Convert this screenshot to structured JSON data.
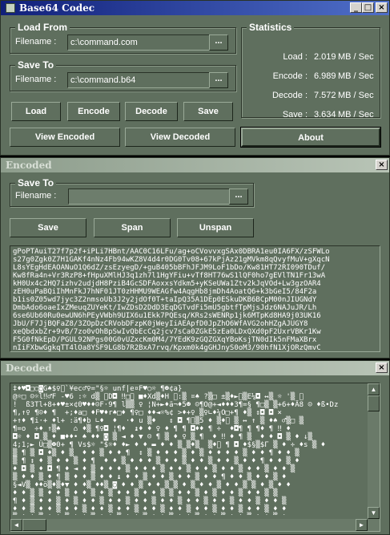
{
  "codec": {
    "title": "Base64 Codec",
    "load_from": {
      "title": "Load From",
      "filename_label": "Filename :",
      "filename": "c:\\command.com",
      "browse": "..."
    },
    "save_to": {
      "title": "Save To",
      "filename_label": "Filename :",
      "filename": "c:\\command.b64",
      "browse": "..."
    },
    "buttons": {
      "load": "Load",
      "encode": "Encode",
      "decode": "Decode",
      "save": "Save",
      "view_encoded": "View Encoded",
      "view_decoded": "View Decoded",
      "about": "About"
    },
    "stats": {
      "title": "Statistics",
      "rows": [
        {
          "label": "Load :",
          "value": "2.019",
          "unit": "MB / Sec"
        },
        {
          "label": "Encode :",
          "value": "6.989",
          "unit": "MB / Sec"
        },
        {
          "label": "Decode :",
          "value": "7.572",
          "unit": "MB / Sec"
        },
        {
          "label": "Save :",
          "value": "3.634",
          "unit": "MB / Sec"
        }
      ]
    }
  },
  "encoded": {
    "title": "Encoded",
    "save_to": {
      "title": "Save To",
      "filename_label": "Filename :",
      "filename": "",
      "browse": "..."
    },
    "buttons": {
      "save": "Save",
      "span": "Span",
      "unspan": "Unspan"
    },
    "text": "gPoPTAuiT27f7p2f+iPLi7HBnt/AAC0C16LFu/ag+oCVovvxgSAx0DBRA1eu0IA6FX/zSFWLo\ns27g0Zgk0Z7H1GAKf4nNz4Fb94wKZ8V4d4r0DG0Tv08+67kPjAz21gMVkm8qQvyfMuV+gXqcN\nL8sYEgHdEAOANuO1Q6dZ/zsEzyegD/+guB405bBFhJFJM9LoF1bDo/Kw81HT72RI090TDuf/\nKw8fRa4n+Vr3RzP8+fHpuXMlHJ3q1zh7l1HgYFiu+vTf8HT76wS1lQF0ho7gEVlTN1Fr13wA\nkH0Ux4c2HQ7izhv2udjdH8PziB4GcSDFAoxxsYdkm5+yKSeUWa1Ztv2kJqVOd+Lw3gzOAR4\nzEH0uPaBQiIhMnFkJ7hNF01JT0zHHMU9WEAGfw4AqgHb8jmDh4AoatQ6+k3bGeI5/84F2a\nb1is0Z05wd7jyc3Z2nmsoUb3J2y2jdOf0T+taIpQ35A1DEp0ESkuDKB6BCpM00nJIUGNdY\nDmbAdo6oaeIxZMeuqZUYeKt/IwZDsD2DdD3EqDGTvdFi5mU5gbtfTpMjsJdz6NAJuJR/Lh\n6se6Ub60Ru0ewUN6hPEyVWbh9UIX6u1Ekk7PQEsq/KRs2sWENRp1jk6MTpKd8HA9j03UK16\nJbU/F7JjBQFaZ8/3ZOpDzCRVobDFzpK0jWeyIiAEApfD0JpZhO6WfAVG2ohHZgAJUGY8\nxeQbdxbZr+9vB/7zo0vOhBpSwIvQbEcCq2jcv7sCa0ZGkE5zEa0LDxQXd0pF2UxrVBKr1Kw\nF5G0fNkEpD/PGUL92NPgs00G0vUZxcKm0M4/7YEdK9zGQZGXqYBoKsjTN0dIk5nFMaXBrx\nnIiFXbwGgkqTT4lOa8YSF9LG8b7R2BxA7rvq/Kpxm0k4gGHJnyS0oM3/90hfN1XjORzQmvC"
  },
  "decoded": {
    "title": "Decoded",
    "text": "‡♦♥◘□○◙G♠$♀\u0000`¥ec♂♀=\"§☼ unf|e¤F♥○☼ ¶☻¢a}\n@☼□ ☺☼l‼♂F -♥6 :☼ d▒ \u0000D◘ ‼□\u0000 ■♦Xd▒♦H \u0000:▒ ¤♠ ?▒□ ±▒♦►\u0000▒E¼◘ ↔▒ ☼ '▒ \u0000\n!  ß3Tl+8+♦♥±×¢0♥♦♦☺F·9¶ l▒▒ ♀ ¦N+►♦ä¬♦5☻ ☺¶O@+◄♦♦♦3¶=§ ¶□▒ ▒+6+♦Ä8 ☺ ♦ß•Dz\n¶,↑♀ ¶☺♦ ¶  +;♦a□ ♦F♥♦r♠□♦ ¶♀□ ♦♦◄☼%¢ >♦+♀ ▒♀∟♦¼O□+¶ ♦▒ ↕◘ ◘ ×\n+↑♦ ¶i·+ ♦l+ :ä¶♦b ∟♦  ♦  ·♦ u ▒♦   ↕ ◘ ¶\u0000▒5 ♦ ▒♦\u0000 ▒ ↔ ↑ ▒ ♦♠ ♂▒□ ▒\n¶=o  ÷♦ ↑▒♠   ⌂ ♦▒ ¶♀◘ ¦¶♦  ↨♦ ♦ ♀ ♦ ¶ ¶ ◘♦♦ ¶ ÷  ♦◘¶ ¶ ¶♦ ¶ ‼ ♦\n◘☼ ♦ ◘ ▒ ♦ ■♦♦• ♠ ♦♦ ◙ ▒ ◄ ♦ ▼ ☺ ¶ ▒ ♦ ♀ ▒ ¶  ♦ ‼ ♦ ¶ ▒  ♦ ♦ ◘ ▒ ♦ ↓▒\n4;1;► Ü□▒☻0+ ¶ Vs$☼ \"$☼♦ ♦► ♦ ♦ ▬ ♦ ♦ ▒ ▒♦▒  ▒♦\u0000 ¶ ◘ ♦$§▒$Γ ▒ ♦ ÷ ♦s ▒ ♦\n▒ ¶ ▒ ◘ ♦▒ ♦ ▒  ♦ ♦ ▒ ♦ ♦ ¶  ↕ ▒ ♦ ♦ ♦ ▒ ♦ ▒ ♦ ♦ ♦ ♦ ▒ ♦ ♦ ¶ ♦ ♦ ▒\n▒ ¶ ↕ ♦ ▒ ♦ ♦ ▒ ♦ ¶  ♦ ♦ ▒ ♦ ♦ ♦ ▒ ♦ ♦ ▒ ♦ ♦ ▒ ♦ ♦ ▒ ♦ ♦ ¶ ♦ ♦ ▒ ♦\n♦ ◘ ▒ ♦ ◘ ¶ ♦ ◄ ♦ ▒ ♦ ♦ ♦ ▒ ♦ ♦ ♦ ▒ ♦ ♦ ▒ ♦ ♦ ▒ ♦ ♦ ▒ ♦ ♦ ▒ ♦ ♦ ▒\n▒ ♦ ♦ ▒ ♦ ¶ ▒ ♦ ♦ ▒ ♦ ♦ ↨ ♦ ♦ ▒ ♦ ♦ ▒ ♦ ♦ ▒ ♦ ♦ ¶ ♦ ♦ ▒ ♦ ♦ ▒ ♦\n§◄V▒ ♦♦ö▒♦▒♦▼ ♦ ♦▒ ♦♦▒ ◙ ♦ ♦ ▒ ♦ ♦ ▒ ▒ ♦ ▒ ♦ ♦ ▒ ♦ ♦ ▒ ▒ ♦ ▒ ♦ ♦\n♦ ♦ ▒ ▒ ♦ ♦ ▒ ♦ ♦ ▒ ♦ ▒ ♦ ♦ ▒ ♦ ♦ ▒ ▒ ♦ ♦ ▒ ♦ ▒ ♦ ♦ ▒ ♦ ♦ ▒ ▒\n¶ ♦ ▒ ♦ ♦ ▒ ♦ ▒ ♦ ♦ ▒ ♦ ♦ ▒ ♦ ♦ ▒ ♦ ♦ ▒ ♦ ♦ ▒ ♦ ♦ ▒ ♦ ♦ ▒ ♦ ♦ ▒\n♦ ♦ ▒ ♦ ♦ ▒ ♦ ♦ ▒ ♦ ♦ ▒ ♦ ♦ ▒ ♦ ♦ ▒ ♦ ♦ ▒ ♦ ♦ ▒ ♦ ♦ ▒ ♦ ♦ ▒ ♦ ♦\n▒ ♦ ♦ ▒ ♦ ♦ ▒ ♦ ♦ ▒ ♦ ♦ ▒ ♦ ♦ ▒ ♦ ♦ ▒ ♦ ♦ ▒ ♦ ♦ ▒ ♦ ♦ ▒ ♦ ♦ ▒ ♦\n♦ ▒ ♦ ♦ ▒ ♦ ♦ ▒ ♦ ♦ ▒ ♦ ♦ ▒ ♦ ♦ ▒ ♦ ♦ ▒ ♦ ♦ ▒ ♦ ♦ ▒ ♦ ♦ ▒ ♦ ♦ ▒\n▒ ♦ ♦ ▒ ♦ ♦ ▒ ♦ ♦ ▒ ♦ ♦ ▒ ♦ ♦ ▒ ♦ ♦ ▒ ♦ ♦ ▒ ♦ ♦ ▒ ♦ ♦ ▒ ♦ ♦ ▒ ♦"
  },
  "colors": {
    "panel": "#5f6f5e",
    "active_title": "#11207a",
    "inactive_title": "#8d9d8c",
    "text": "#ffffff"
  }
}
